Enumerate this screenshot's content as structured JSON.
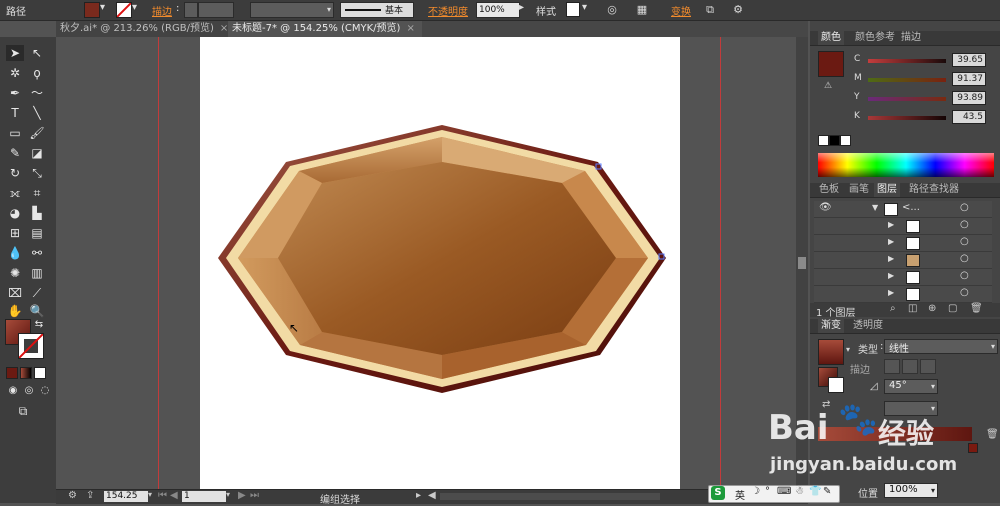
{
  "control_bar": {
    "object_type": "路径",
    "stroke_label": "描边",
    "stroke_weight": ":",
    "brush_label": "基本",
    "opacity_label": "不透明度",
    "opacity_value": "100%",
    "style_label": "样式",
    "transform_label": "变换"
  },
  "tabs": [
    {
      "label": "秋夕.ai* @ 213.26% (RGB/预览)",
      "close": "×"
    },
    {
      "label": "未标题-7* @ 154.25% (CMYK/预览)",
      "close": "×"
    }
  ],
  "color_panel": {
    "tabs": [
      "颜色",
      "颜色参考",
      "描边"
    ],
    "channels": [
      {
        "name": "C",
        "value": "39.65"
      },
      {
        "name": "M",
        "value": "91.37"
      },
      {
        "name": "Y",
        "value": "93.89"
      },
      {
        "name": "K",
        "value": "43.5"
      }
    ],
    "fill_color": "#6b1a12"
  },
  "layers_panel": {
    "tabs": [
      "色板",
      "画笔",
      "图层",
      "路径查找器"
    ],
    "footer": "1 个图层",
    "group_label": "<...",
    "rows": 6
  },
  "gradient_panel": {
    "tabs": [
      "渐变",
      "透明度"
    ],
    "type_label": "类型",
    "type_value": "线性",
    "stroke_label": "描边",
    "angle_value": "45°",
    "position_label": "位置",
    "position_value": "100%"
  },
  "status_bar": {
    "zoom": "154.25",
    "page": "1",
    "tool_status": "编组选择"
  },
  "ime": {
    "lang": "英"
  },
  "watermark": {
    "brand": "Bai",
    "brand2": "经验",
    "url": "jingyan.baidu.com"
  },
  "colors": {
    "accent": "#f28b2c",
    "ui_dark": "#3c3c3c",
    "canvas_bg": "#535353"
  }
}
